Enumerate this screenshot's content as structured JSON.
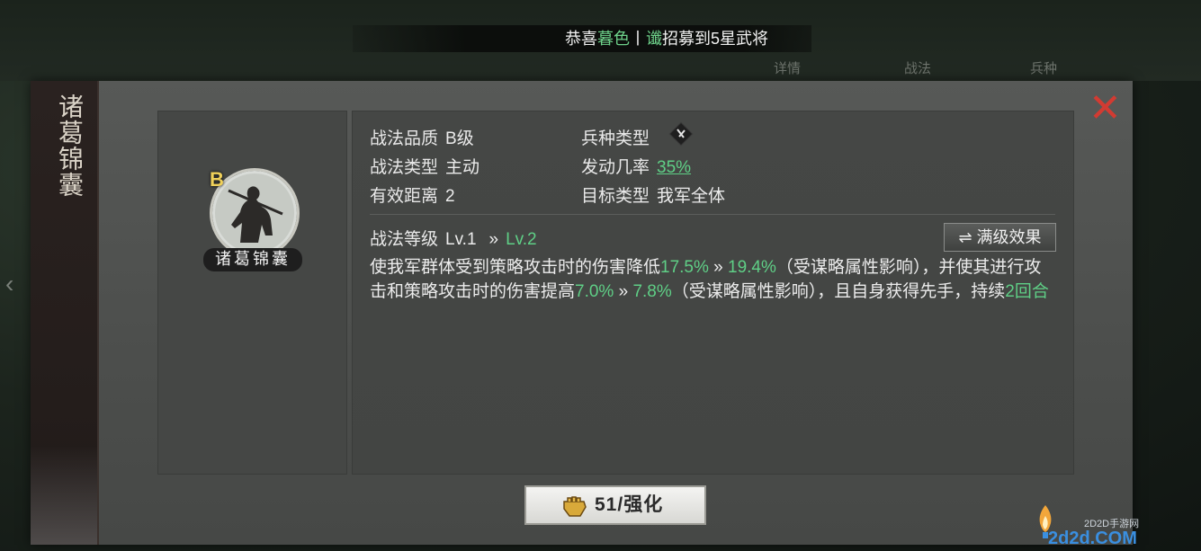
{
  "background": {
    "tabs": [
      "详情",
      "战法",
      "兵种"
    ]
  },
  "broadcast": {
    "prefix": "恭喜",
    "player": "暮色",
    "sep": "丨",
    "tag": "谶",
    "text": "招募到5星武将"
  },
  "banner": {
    "title": "诸葛锦囊"
  },
  "skill": {
    "grade_badge": "B",
    "name_plate": "诸葛锦囊",
    "quality_label": "战法品质",
    "quality_value": "B级",
    "type_label": "战法类型",
    "type_value": "主动",
    "range_label": "有效距离",
    "range_value": "2",
    "troop_label": "兵种类型",
    "troop_icon": "troop-type-icon",
    "rate_label": "发动几率",
    "rate_value": "35%",
    "target_label": "目标类型",
    "target_value": "我军全体",
    "level_label": "战法等级",
    "level_current": "Lv.1",
    "level_arrow": "»",
    "level_next": "Lv.2",
    "max_level_button": "满级效果",
    "max_level_icon": "swap-arrows-icon"
  },
  "description": {
    "p1": "使我军群体受到策略攻击时的伤害降低",
    "v1a": "17.5%",
    "arrow": " » ",
    "v1b": "19.4%",
    "p2": "（受谋略属性影响），并使其进行攻击和策略攻击时的伤害提高",
    "v2a": "7.0%",
    "v2b": "7.8%",
    "p3": "（受谋略属性影响），且自身获得先手，持续",
    "v3": "2回合"
  },
  "enhance": {
    "label": "51/强化",
    "icon": "fist-icon"
  },
  "watermark": {
    "small": "2D2D手游网",
    "big": "2d2d.COM"
  },
  "colors": {
    "accent_green": "#5fcf86",
    "close_red": "#d23b32",
    "grade_gold": "#f0d15a"
  }
}
